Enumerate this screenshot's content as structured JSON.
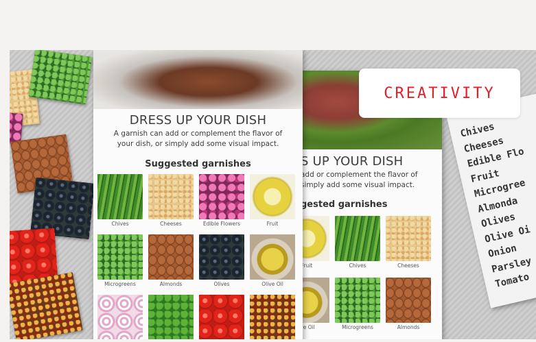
{
  "badge": {
    "label": "CREATIVITY",
    "color": "#e0202a"
  },
  "poster": {
    "title": "DRESS UP YOUR DISH",
    "subtitle_line1": "A garnish can add or complement the flavor of",
    "subtitle_line2": "your dish, or simply add some visual impact.",
    "heading": "Suggested garnishes",
    "garnishes": [
      {
        "name": "Chives",
        "texture": "chives"
      },
      {
        "name": "Cheeses",
        "texture": "cheese"
      },
      {
        "name": "Edible Flowers",
        "texture": "flower"
      },
      {
        "name": "Fruit",
        "texture": "fruit"
      },
      {
        "name": "Microgreens",
        "texture": "micro"
      },
      {
        "name": "Almonds",
        "texture": "almond"
      },
      {
        "name": "Olives",
        "texture": "olive"
      },
      {
        "name": "Olive Oil",
        "texture": "oil"
      },
      {
        "name": "",
        "texture": "onion"
      },
      {
        "name": "",
        "texture": "parsley"
      },
      {
        "name": "",
        "texture": "tomato"
      },
      {
        "name": "",
        "texture": "chili"
      }
    ]
  },
  "poster2": {
    "title": "S UP YOUR DISH",
    "subtitle_line1": "add or complement the flavor of",
    "subtitle_line2": "simply add some visual impact.",
    "heading": "gested garnishes",
    "garnishes": [
      {
        "name": "Fruit",
        "texture": "fruit"
      },
      {
        "name": "Chives",
        "texture": "chives"
      },
      {
        "name": "Cheeses",
        "texture": "cheese"
      },
      {
        "name": "ive Oil",
        "texture": "oil"
      },
      {
        "name": "Microgreens",
        "texture": "micro"
      },
      {
        "name": "Almonds",
        "texture": "almond"
      }
    ]
  },
  "note": {
    "items": [
      "Chives",
      "Cheeses",
      "Edible Flo",
      "Fruit",
      "Microgree",
      "Almonda",
      "Olives",
      "Olive Oi",
      "Onion",
      "Parsley",
      "Tomato"
    ]
  }
}
